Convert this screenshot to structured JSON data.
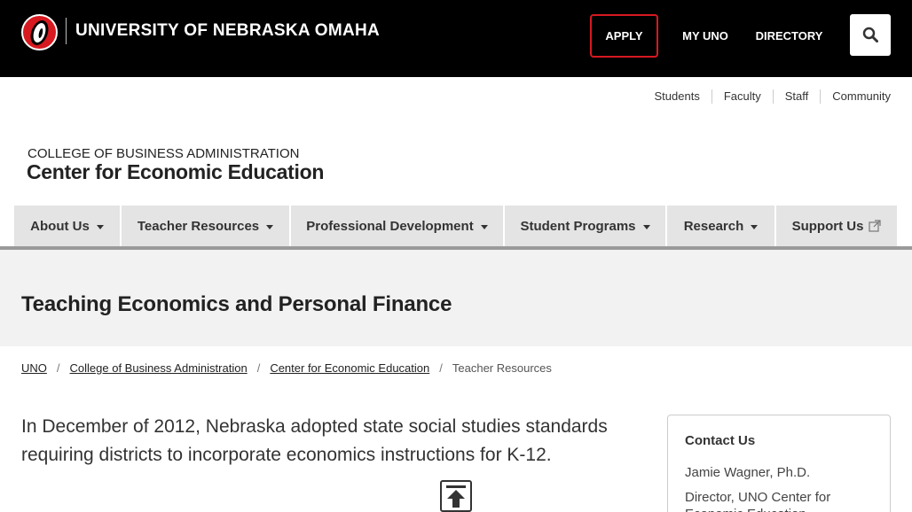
{
  "header": {
    "university_name": "UNIVERSITY OF NEBRASKA OMAHA",
    "apply_label": "APPLY",
    "myuno_label": "MY UNO",
    "directory_label": "DIRECTORY",
    "search_icon": "search-icon",
    "logo_icon": "uno-o-logo"
  },
  "audience_links": [
    "Students",
    "Faculty",
    "Staff",
    "Community"
  ],
  "site": {
    "college": "COLLEGE OF BUSINESS ADMINISTRATION",
    "center": "Center for Economic Education"
  },
  "nav": {
    "items": [
      {
        "label": "About Us"
      },
      {
        "label": "Teacher Resources"
      },
      {
        "label": "Professional Development"
      },
      {
        "label": "Student Programs"
      },
      {
        "label": "Research"
      },
      {
        "label": "Support Us"
      }
    ]
  },
  "page": {
    "title": "Teaching Economics and Personal Finance",
    "lead": "In December of 2012, Nebraska adopted state social studies standards requiring districts to incorporate economics instructions for K-12."
  },
  "breadcrumb": {
    "items": [
      "UNO",
      "College of Business Administration",
      "Center for Economic Education",
      "Teacher Resources"
    ],
    "separator": "/"
  },
  "contact": {
    "heading": "Contact Us",
    "name": "Jamie Wagner, Ph.D.",
    "role": "Director, UNO Center for Economic Education"
  },
  "colors": {
    "header_bg": "#000000",
    "accent_red": "#d71920",
    "nav_bg": "#e4e4e4",
    "title_band_bg": "#f2f2f2"
  }
}
